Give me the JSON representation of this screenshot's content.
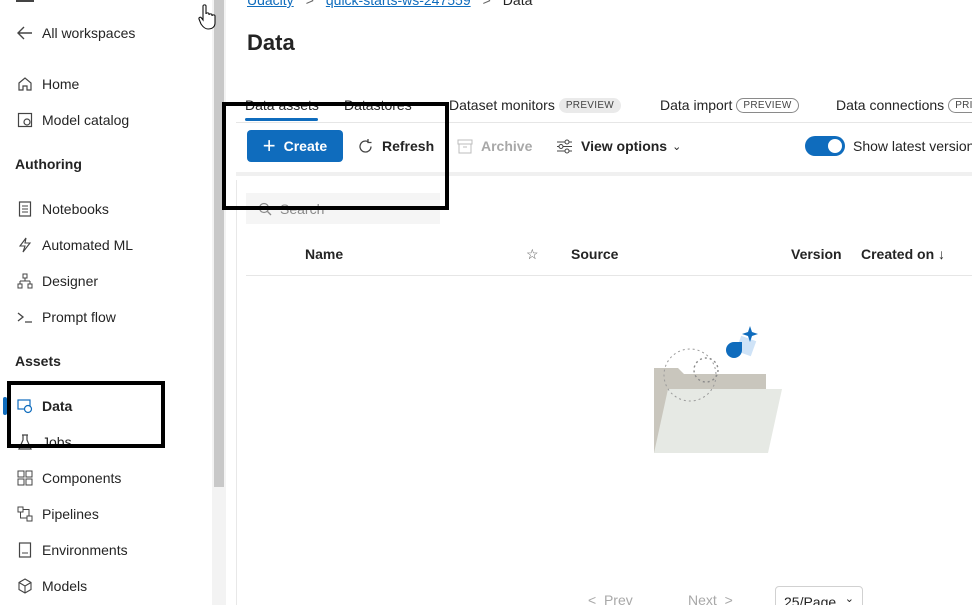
{
  "sidebar": {
    "back_label": "All workspaces",
    "items_top": [
      {
        "label": "Home",
        "icon": "home-icon"
      },
      {
        "label": "Model catalog",
        "icon": "catalog-icon"
      }
    ],
    "authoring_heading": "Authoring",
    "authoring_items": [
      {
        "label": "Notebooks",
        "icon": "notebook-icon"
      },
      {
        "label": "Automated ML",
        "icon": "automl-icon"
      },
      {
        "label": "Designer",
        "icon": "designer-icon"
      },
      {
        "label": "Prompt flow",
        "icon": "prompt-flow-icon"
      }
    ],
    "assets_heading": "Assets",
    "assets_items": [
      {
        "label": "Data",
        "icon": "data-icon",
        "active": true
      },
      {
        "label": "Jobs",
        "icon": "jobs-icon"
      },
      {
        "label": "Components",
        "icon": "components-icon"
      },
      {
        "label": "Pipelines",
        "icon": "pipelines-icon"
      },
      {
        "label": "Environments",
        "icon": "environments-icon"
      },
      {
        "label": "Models",
        "icon": "models-icon"
      }
    ]
  },
  "breadcrumb": {
    "items": [
      "Udacity",
      "quick-starts-ws-247559",
      "Data"
    ]
  },
  "page_title": "Data",
  "tabs": [
    {
      "label": "Data assets",
      "active": true
    },
    {
      "label": "Datastores"
    },
    {
      "label": "Dataset monitors",
      "badge": "PREVIEW"
    },
    {
      "label": "Data import",
      "badge": "PREVIEW"
    },
    {
      "label": "Data connections",
      "badge": "PRI"
    }
  ],
  "toolbar": {
    "create_label": "Create",
    "refresh_label": "Refresh",
    "archive_label": "Archive",
    "view_options_label": "View options",
    "show_latest_label": "Show latest version",
    "show_latest_on": true
  },
  "search": {
    "placeholder": "Search"
  },
  "table": {
    "columns": [
      "Name",
      "Source",
      "Version",
      "Created on ↓"
    ]
  },
  "pager": {
    "prev_label": "Prev",
    "next_label": "Next",
    "page_size": "25/Page"
  },
  "colors": {
    "accent": "#0f6cbd",
    "annotation": "#000000"
  }
}
